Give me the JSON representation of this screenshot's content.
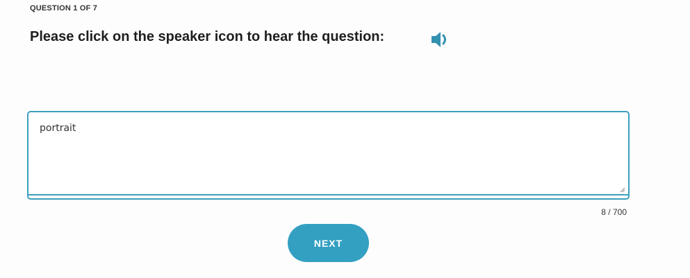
{
  "progress_label": "QUESTION 1 OF 7",
  "question": {
    "prompt": "Please click on the speaker icon to hear the question:",
    "audio_icon": "speaker-icon"
  },
  "answer": {
    "value": "portrait",
    "counter": "8 / 700"
  },
  "next_button": {
    "label": "NEXT"
  },
  "colors": {
    "accent": "#33a0c2",
    "border": "#3a9fbd",
    "background": "#fdfdfd"
  }
}
